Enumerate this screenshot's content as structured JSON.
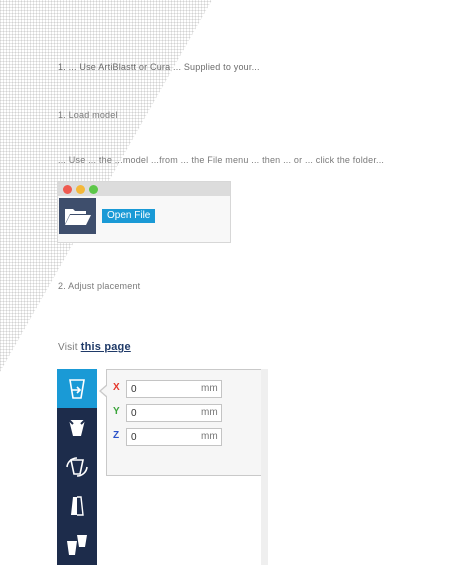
{
  "doc": {
    "heading": "1. ...  Use ArtiBlastt  or Cura ... Supplied to your...",
    "step1": "1. Load model",
    "step1_desc": "... Use ... the ...model ...from ... the File menu ... then ... or ... click the folder...",
    "step2": "2. Adjust placement",
    "visit_prefix": "Visit",
    "visit_link": "this page"
  },
  "open_file_window": {
    "open_file_label": "Open File",
    "traffic_lights": {
      "close": "#ef5a50",
      "minimize": "#f4b83a",
      "zoom": "#5dc749"
    },
    "folder_icon": "folder-open-icon"
  },
  "tool_sidebar": {
    "tools": [
      {
        "icon": "move-tool-icon",
        "active": true
      },
      {
        "icon": "scale-tool-icon",
        "active": false
      },
      {
        "icon": "rotate-tool-icon",
        "active": false
      },
      {
        "icon": "mirror-tool-icon",
        "active": false
      },
      {
        "icon": "per-model-settings-icon",
        "active": false
      }
    ]
  },
  "xyz_panel": {
    "axes": [
      {
        "label": "X",
        "value": "0",
        "unit": "mm",
        "color": "#e5372b"
      },
      {
        "label": "Y",
        "value": "0",
        "unit": "mm",
        "color": "#3aa43a"
      },
      {
        "label": "Z",
        "value": "0",
        "unit": "mm",
        "color": "#2a52c9"
      }
    ]
  },
  "colors": {
    "accent": "#1a9ad6",
    "sidebar": "#1d2c4b"
  }
}
